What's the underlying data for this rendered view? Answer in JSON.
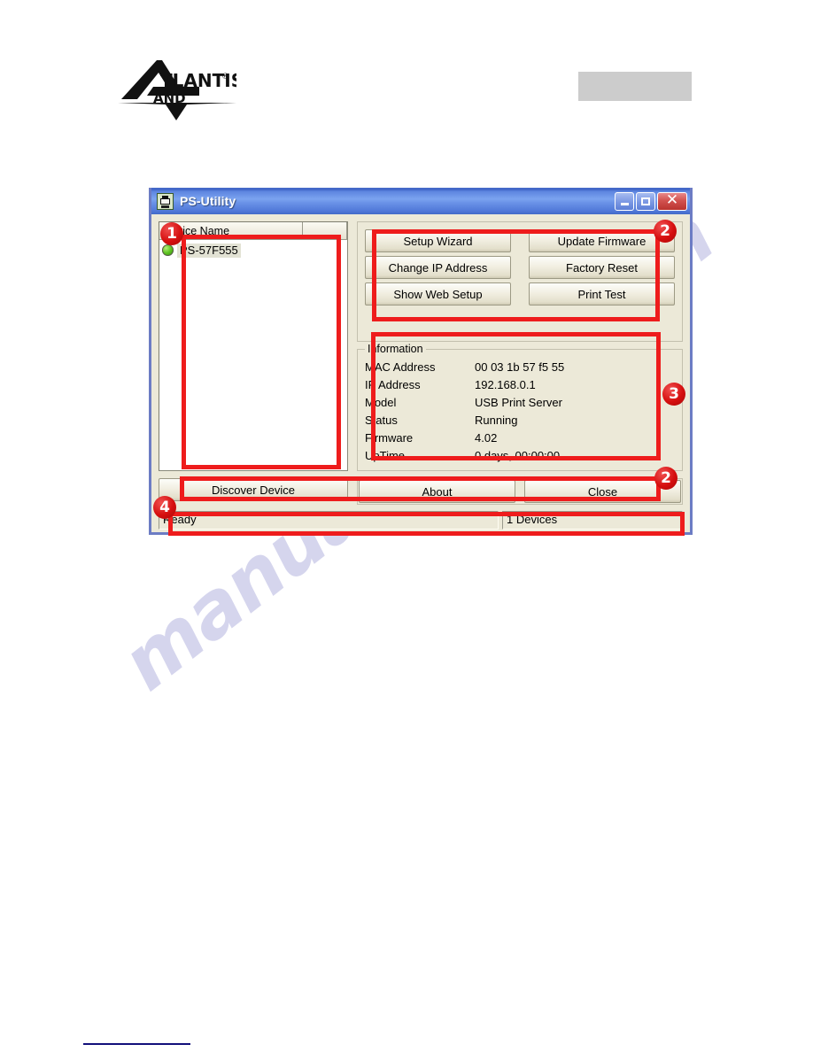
{
  "page": {
    "watermark": "manualshive.com",
    "logo_alt": "ATLANTIS LAND"
  },
  "window": {
    "title": "PS-Utility",
    "icon": "print-server-icon",
    "controls": {
      "minimize": "minimize-icon",
      "maximize": "maximize-icon",
      "close": "close-icon"
    }
  },
  "device_list": {
    "columns": [
      "Device Name",
      ""
    ],
    "rows": [
      {
        "status_led": "green",
        "name": "PS-57F555"
      }
    ]
  },
  "actions": {
    "buttons": [
      "Setup Wizard",
      "Update Firmware",
      "Change IP Address",
      "Factory Reset",
      "Show Web Setup",
      "Print Test"
    ]
  },
  "information": {
    "legend": "Information",
    "rows": [
      {
        "label": "MAC Address",
        "value": "00 03 1b 57 f5 55"
      },
      {
        "label": "IP Address",
        "value": "192.168.0.1"
      },
      {
        "label": "Model",
        "value": "USB Print Server"
      },
      {
        "label": "Status",
        "value": "Running"
      },
      {
        "label": "Firmware",
        "value": "4.02"
      },
      {
        "label": "UpTime",
        "value": "0 days, 00:00:00"
      }
    ]
  },
  "bottom_buttons": {
    "discover": "Discover Device",
    "about": "About",
    "close": "Close"
  },
  "statusbar": {
    "message": "Ready",
    "device_count": "1 Devices"
  },
  "annotations": {
    "badges": [
      "1",
      "2",
      "3",
      "2",
      "4"
    ]
  },
  "colors": {
    "annotation_red": "#ee1c1c",
    "titlebar_blue": "#5d85e0",
    "dialog_face": "#ece9d8",
    "led_green": "#5fc423",
    "watermark": "#c8c8e8",
    "rule_blue": "#12107a"
  }
}
